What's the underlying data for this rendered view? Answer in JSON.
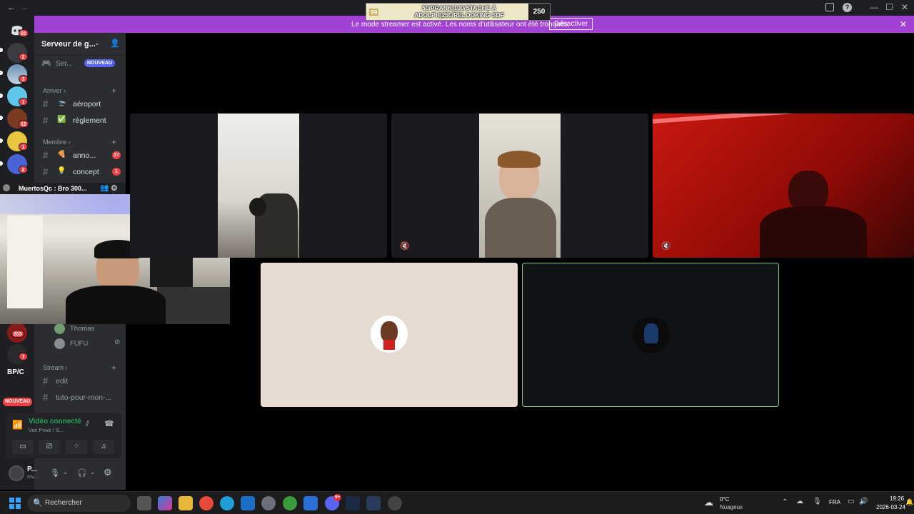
{
  "window": {
    "back_glyph": "←",
    "forward_glyph": "→",
    "controls": [
      "—",
      "☐",
      "✕"
    ]
  },
  "overlay": {
    "left_value": "99",
    "line1": "50/PRANK|100/STACHE À",
    "line2": "ADOLPH|250/RELOOKING SDF",
    "right_value": "250"
  },
  "banner": {
    "message": "Le mode streamer est activé. Les noms d'utilisateur ont été tronqués.",
    "disable_label": "Désactiver",
    "close_glyph": "✕"
  },
  "rail": {
    "badges": [
      "81",
      "2",
      "3",
      "1",
      "12",
      "1",
      "2",
      "203",
      "7",
      "NOUVEAU"
    ],
    "bpc_label": "BP/C"
  },
  "sidebar": {
    "server_name": "Serveur de g...",
    "server_guide": "Ser...",
    "new_badge": "NOUVEAU",
    "categories": {
      "arriver": "Arriver",
      "membre": "Membre",
      "stream": "Stream"
    },
    "channels": [
      {
        "emoji": "🛬",
        "label": "aéroport",
        "badge": ""
      },
      {
        "emoji": "✅",
        "label": "règlement",
        "badge": ""
      },
      {
        "emoji": "🍕",
        "label": "anno...",
        "badge": "17"
      },
      {
        "emoji": "💡",
        "label": "concept",
        "badge": "1"
      }
    ],
    "voice_users": [
      "Thomas",
      "FUFU"
    ],
    "stream_channels": [
      "edit",
      "tuto-pour-mon-..."
    ]
  },
  "webcam": {
    "title": "MuertosQc : Bro 300..."
  },
  "voice": {
    "status": "Vidéo connecté",
    "channel": "Voc Privé / S..."
  },
  "user": {
    "name": "P...",
    "status": "Inv..."
  },
  "taskbar": {
    "search_placeholder": "Rechercher",
    "weather_temp": "0°C",
    "weather_desc": "Nuageux",
    "lang": "FRA",
    "time": "19:26",
    "date": "2026-03-24",
    "discord_badge": "9+"
  },
  "colors": {
    "banner": "#a340d6",
    "sidebar": "#2b2d31",
    "rail": "#1e1f22",
    "voice_green": "#23a559",
    "active_border": "#7fd07f"
  }
}
